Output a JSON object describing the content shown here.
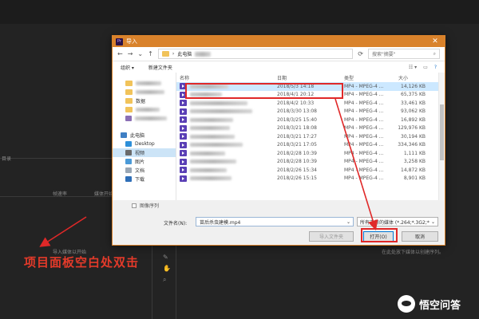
{
  "app": {
    "label_top_left": "目录",
    "label_import": "导入媒体以开始",
    "label_col_framerate": "帧速率",
    "label_col_mediastart": "媒体开始",
    "label_right_hint": "在此处放下媒体以创建序列。"
  },
  "dialog": {
    "title": "导入",
    "address_prefix": "此电脑",
    "search_placeholder": "搜索\"摘要\"",
    "organize": "组织 ▾",
    "new_folder": "新建文件夹",
    "sidebar": [
      {
        "label": "数据",
        "icon": "folder"
      },
      {
        "label": "此电脑",
        "icon": "computer"
      },
      {
        "label": "Desktop",
        "icon": "desktop"
      },
      {
        "label": "视频",
        "icon": "video",
        "selected": true
      },
      {
        "label": "图片",
        "icon": "pictures"
      },
      {
        "label": "文档",
        "icon": "documents"
      },
      {
        "label": "下载",
        "icon": "downloads"
      }
    ],
    "columns": {
      "name": "名称",
      "date": "日期",
      "type": "类型",
      "size": "大小"
    },
    "files": [
      {
        "date": "2018/5/3 14:18",
        "type": "MP4 - MPEG-4 ...",
        "size": "14,126 KB",
        "selected": true
      },
      {
        "date": "2018/4/1 20:12",
        "type": "MP4 - MPEG-4 ...",
        "size": "65,375 KB"
      },
      {
        "date": "2018/4/2 10:33",
        "type": "MP4 - MPEG-4 ...",
        "size": "33,461 KB"
      },
      {
        "date": "2018/3/30 13:08",
        "type": "MP4 - MPEG-4 ...",
        "size": "93,062 KB"
      },
      {
        "date": "2018/3/25 15:40",
        "type": "MP4 - MPEG-4 ...",
        "size": "16,892 KB"
      },
      {
        "date": "2018/3/21 18:08",
        "type": "MP4 - MPEG-4 ...",
        "size": "129,976 KB"
      },
      {
        "date": "2018/3/21 17:27",
        "type": "MP4 - MPEG-4 ...",
        "size": "30,194 KB"
      },
      {
        "date": "2018/3/21 17:05",
        "type": "MP4 - MPEG-4 ...",
        "size": "334,346 KB"
      },
      {
        "date": "2018/2/28 10:39",
        "type": "MP4 - MPEG-4 ...",
        "size": "1,111 KB"
      },
      {
        "date": "2018/2/28 10:39",
        "type": "MP4 - MPEG-4 ...",
        "size": "3,258 KB"
      },
      {
        "date": "2018/2/26 15:34",
        "type": "MP4 - MPEG-4 ...",
        "size": "14,872 KB"
      },
      {
        "date": "2018/2/26 15:15",
        "type": "MP4 - MPEG-4 ...",
        "size": "8,901 KB"
      }
    ],
    "hidden_option": "图像序列",
    "filename_label": "文件名(N):",
    "filename_value": "苗后杀虫建模.mp4",
    "filetype_value": "所有支持的媒体 (*.264;*.3G2;*",
    "import_folder_button": "导入文件夹",
    "open_button": "打开(O)",
    "cancel_button": "取消"
  },
  "annotation": {
    "text": "项目面板空白处双击",
    "color": "#e33a2a"
  },
  "watermark": {
    "text": "悟空问答"
  }
}
